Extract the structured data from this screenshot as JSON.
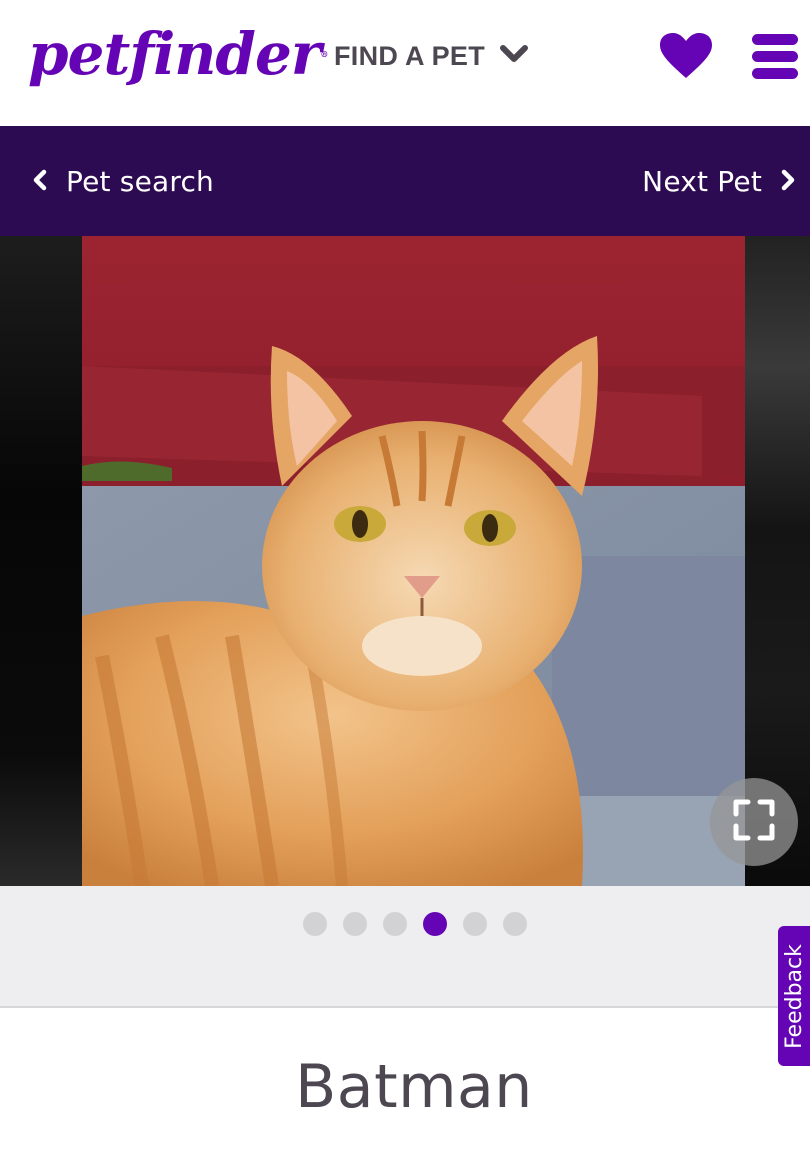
{
  "header": {
    "logo_text": "petfinder",
    "logo_registered": "®",
    "find_pet_label": "FIND A PET",
    "find_pet_icon": "chevron-down-icon",
    "favorites_icon": "heart-icon",
    "menu_icon": "hamburger-menu-icon"
  },
  "subnav": {
    "back_label": "Pet search",
    "back_icon": "chevron-left-icon",
    "next_label": "Next Pet",
    "next_icon": "chevron-right-icon"
  },
  "carousel": {
    "image_description": "Orange tabby cat sitting in front of a red wall and gray stone step",
    "expand_icon": "fullscreen-expand-icon",
    "total_slides": 6,
    "active_slide": 4
  },
  "feedback": {
    "label": "Feedback"
  },
  "pet": {
    "name": "Batman"
  },
  "colors": {
    "brand_purple": "#6504b5",
    "subnav_bg": "#2d0b52",
    "text_dark": "#4d4751",
    "dot_inactive": "#d2d2d5",
    "dots_bg": "#eeedf0"
  }
}
